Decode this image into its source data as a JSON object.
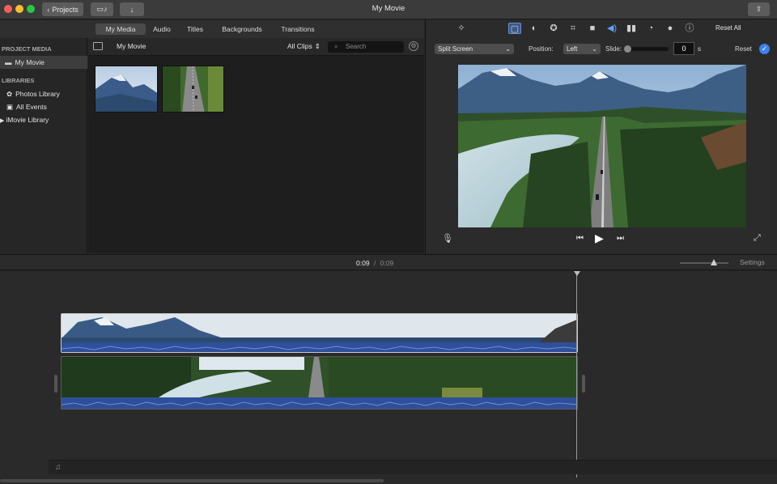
{
  "window": {
    "title": "My Movie"
  },
  "toolbar": {
    "projects_label": "Projects"
  },
  "tabs": [
    "My Media",
    "Audio",
    "Titles",
    "Backgrounds",
    "Transitions"
  ],
  "sidebar": {
    "project_media_header": "PROJECT MEDIA",
    "project_item": "My Movie",
    "libraries_header": "LIBRARIES",
    "libraries": [
      "Photos Library",
      "All Events",
      "iMovie Library"
    ]
  },
  "browser": {
    "title": "My Movie",
    "filter": "All Clips",
    "search_placeholder": "Search"
  },
  "viewer": {
    "reset_all": "Reset All",
    "layout_select": "Split Screen",
    "position_label": "Position:",
    "position_value": "Left",
    "slide_label": "Slide:",
    "slide_value": "0",
    "slide_unit": "s",
    "reset": "Reset"
  },
  "playhead": {
    "current": "0:09",
    "separator": "/",
    "total": "0:09"
  },
  "timeline": {
    "settings": "Settings",
    "zoom_level": 0.7
  }
}
